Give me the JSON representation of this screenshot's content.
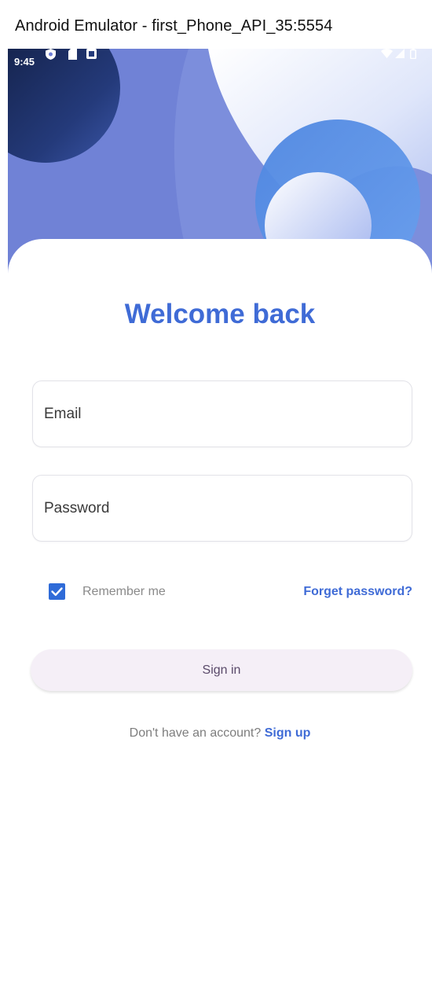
{
  "window": {
    "title": "Android Emulator - first_Phone_API_35:5554"
  },
  "status_bar": {
    "time": "9:45",
    "left_icons": [
      "shield-icon",
      "sim-card-icon",
      "notification-icon"
    ],
    "right_icons": [
      "wifi-icon",
      "signal-icon",
      "battery-icon"
    ]
  },
  "login": {
    "heading": "Welcome back",
    "email_placeholder": "Email",
    "password_placeholder": "Password",
    "remember_label": "Remember me",
    "remember_checked": true,
    "forgot_label": "Forget password?",
    "signin_label": "Sign in",
    "signup_prompt": "Don't have an account?",
    "signup_link": "Sign up"
  },
  "colors": {
    "accent": "#3f6bd6",
    "hero": "#6f7fd6",
    "button_bg": "#f5eff7"
  }
}
